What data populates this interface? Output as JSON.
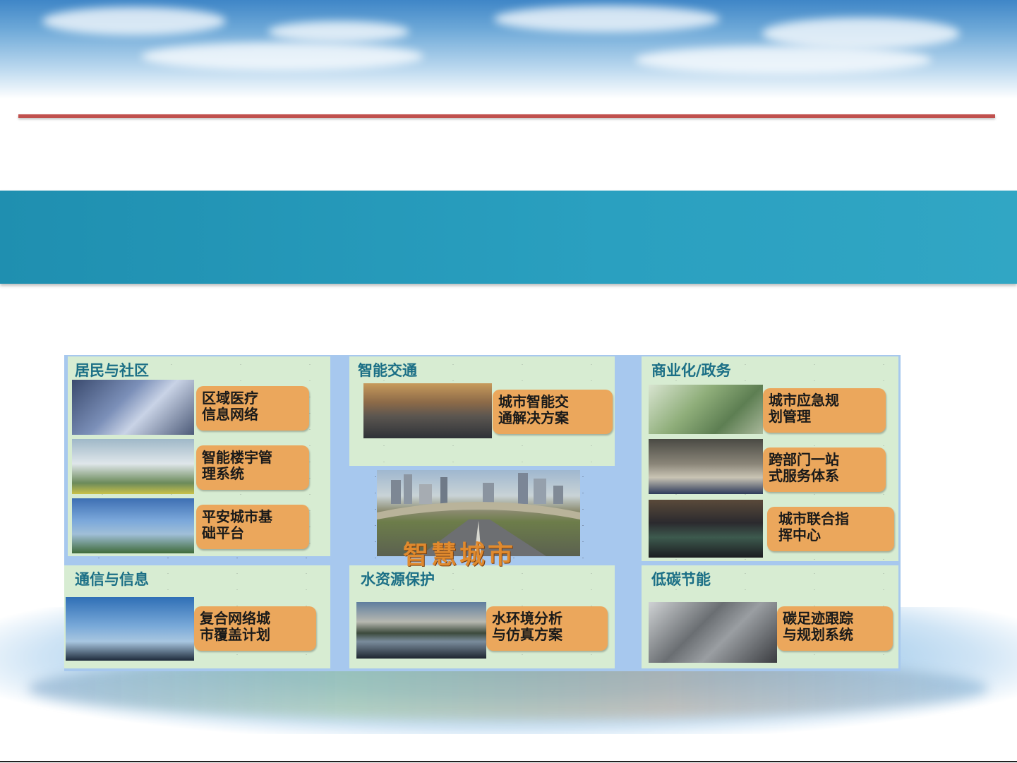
{
  "panels": {
    "residents": {
      "title": "居民与社区",
      "items": [
        {
          "lines": [
            "区域医疗",
            "信息网络"
          ]
        },
        {
          "lines": [
            "智能楼宇管",
            "理系统"
          ]
        },
        {
          "lines": [
            "平安城市基",
            "础平台"
          ]
        }
      ]
    },
    "traffic": {
      "title": "智能交通",
      "items": [
        {
          "lines": [
            "城市智能交",
            "通解决方案"
          ]
        }
      ]
    },
    "business": {
      "title": "商业化/政务",
      "items": [
        {
          "lines": [
            "城市应急规",
            "划管理"
          ]
        },
        {
          "lines": [
            "跨部门一站",
            "式服务体系"
          ]
        },
        {
          "lines": [
            "城市联合指",
            "挥中心"
          ]
        }
      ]
    },
    "communication": {
      "title": "通信与信息",
      "items": [
        {
          "lines": [
            "复合网络城",
            "市覆盖计划"
          ]
        }
      ]
    },
    "water": {
      "title": "水资源保护",
      "items": [
        {
          "lines": [
            "水环境分析",
            "与仿真方案"
          ]
        }
      ]
    },
    "lowcarbon": {
      "title": "低碳节能",
      "items": [
        {
          "lines": [
            "碳足迹跟踪",
            "与规划系统"
          ]
        }
      ]
    }
  },
  "center": {
    "title": "智慧城市"
  },
  "colors": {
    "accent_line": "#c0504d",
    "band": "#2aa0c0",
    "label_bg": "#eba75c",
    "panel_bg": "#d7ecd2",
    "title_text": "#1b6f86"
  }
}
